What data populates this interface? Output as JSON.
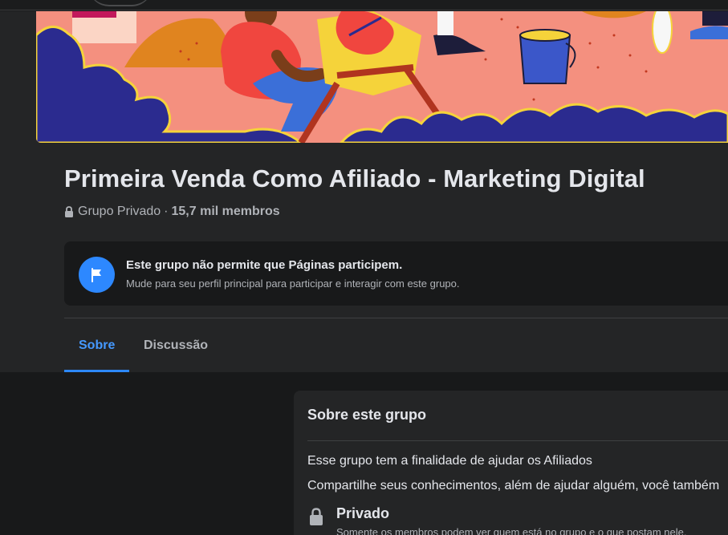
{
  "colors": {
    "page_background": "#18191a",
    "panel_background": "#242526",
    "primary_text": "#e4e6eb",
    "secondary_text": "#b0b3b8",
    "accent_blue": "#2d88ff",
    "cover_pink": "#f4907f",
    "cover_navy": "#2b2b8f"
  },
  "group": {
    "title": "Primeira Venda Como Afiliado - Marketing Digital",
    "privacy": "Grupo Privado",
    "separator": "·",
    "member_count": "15,7 mil membros"
  },
  "notice": {
    "icon": "flag-icon",
    "title": "Este grupo não permite que Páginas participem.",
    "subtitle": "Mude para seu perfil principal para participar e interagir com este grupo."
  },
  "tabs": [
    {
      "label": "Sobre",
      "active": true
    },
    {
      "label": "Discussão",
      "active": false
    }
  ],
  "about": {
    "heading": "Sobre este grupo",
    "description_line1": "Esse grupo tem a finalidade de ajudar os Afiliados",
    "description_line2": "Compartilhe seus conhecimentos, além de ajudar alguém, você também",
    "privacy_icon": "lock-icon",
    "privacy_title": "Privado",
    "privacy_description": "Somente os membros podem ver quem está no grupo e o que postam nele."
  }
}
